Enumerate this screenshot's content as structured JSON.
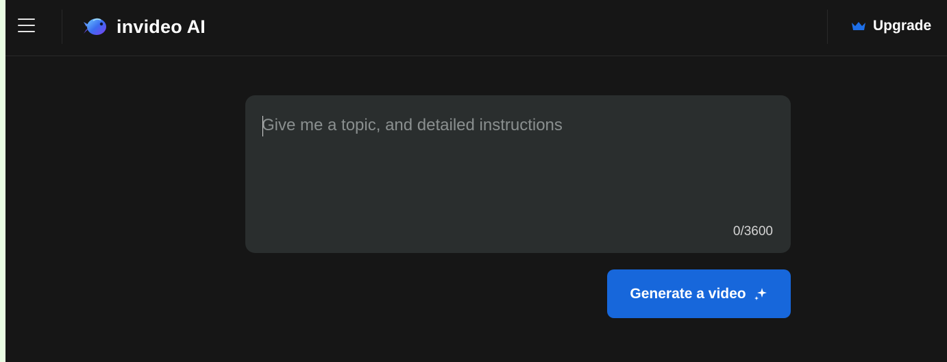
{
  "app": {
    "brand_name": "invideo AI",
    "brand_color": "#1767db"
  },
  "header": {
    "menu_icon": "hamburger-menu-icon",
    "logo_icon": "invideo-fish-logo-icon",
    "upgrade_label": "Upgrade",
    "upgrade_icon": "crown-icon"
  },
  "prompt": {
    "placeholder": "Give me a topic, and detailed instructions",
    "value": "",
    "char_count": "0/3600"
  },
  "actions": {
    "generate_label": "Generate a video",
    "generate_icon": "sparkle-icon"
  },
  "colors": {
    "background": "#161616",
    "panel": "#2a2e2e",
    "accent": "#1767db",
    "page_border": "#e9fce3"
  }
}
